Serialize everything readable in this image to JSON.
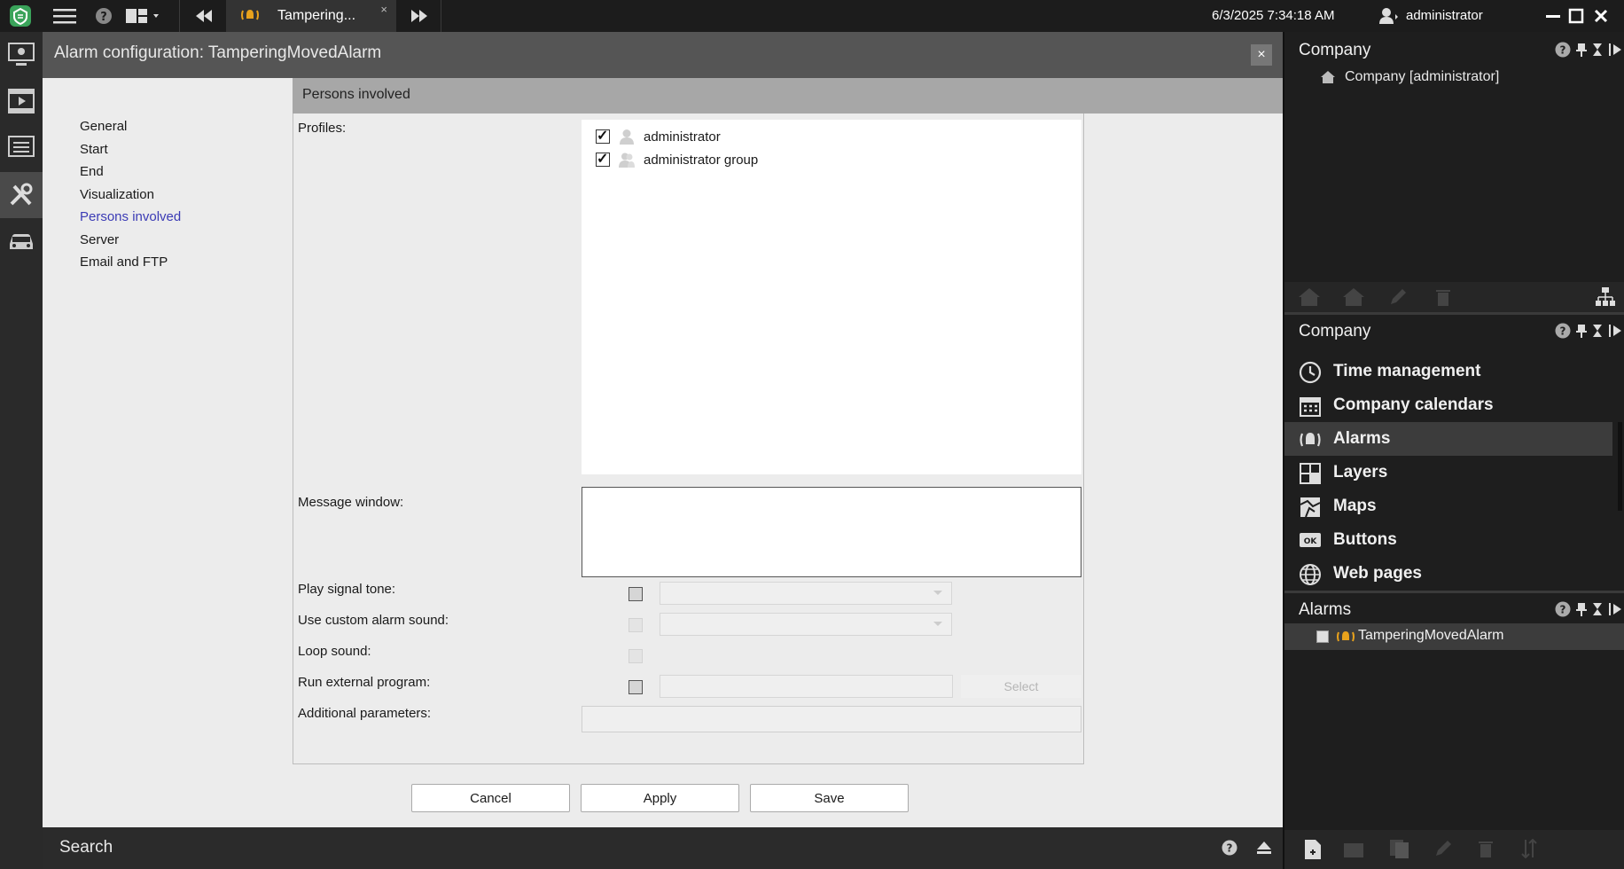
{
  "topbar": {
    "tab_title": "Tampering...",
    "tab_close": "×",
    "datetime": "6/3/2025 7:34:18 AM",
    "user": "administrator"
  },
  "dialog": {
    "title": "Alarm configuration: TamperingMovedAlarm",
    "close": "×",
    "nav": [
      "General",
      "Start",
      "End",
      "Visualization",
      "Persons involved",
      "Server",
      "Email and FTP"
    ],
    "active_nav": "Persons involved",
    "section_title": "Persons involved",
    "labels": {
      "profiles": "Profiles:",
      "message_window": "Message window:",
      "play_signal_tone": "Play signal tone:",
      "custom_alarm_sound": "Use custom alarm sound:",
      "loop_sound": "Loop sound:",
      "run_external_program": "Run external program:",
      "additional_parameters": "Additional parameters:"
    },
    "profiles": [
      {
        "name": "administrator",
        "checked": true
      },
      {
        "name": "administrator group",
        "checked": true
      }
    ],
    "select_button": "Select",
    "buttons": {
      "cancel": "Cancel",
      "apply": "Apply",
      "save": "Save"
    }
  },
  "searchbar": {
    "label": "Search"
  },
  "right_panel": {
    "company_panel": {
      "title": "Company",
      "tree_item": "Company [administrator]"
    },
    "modules_panel": {
      "title": "Company",
      "items": [
        "Time management",
        "Company calendars",
        "Alarms",
        "Layers",
        "Maps",
        "Buttons",
        "Web pages"
      ],
      "active": "Alarms"
    },
    "alarms_panel": {
      "title": "Alarms",
      "item": "TamperingMovedAlarm"
    }
  },
  "colors": {
    "accent_nav": "#3b3bb5",
    "alarm_icon": "#e8a21c",
    "logo": "#3aa35a"
  }
}
